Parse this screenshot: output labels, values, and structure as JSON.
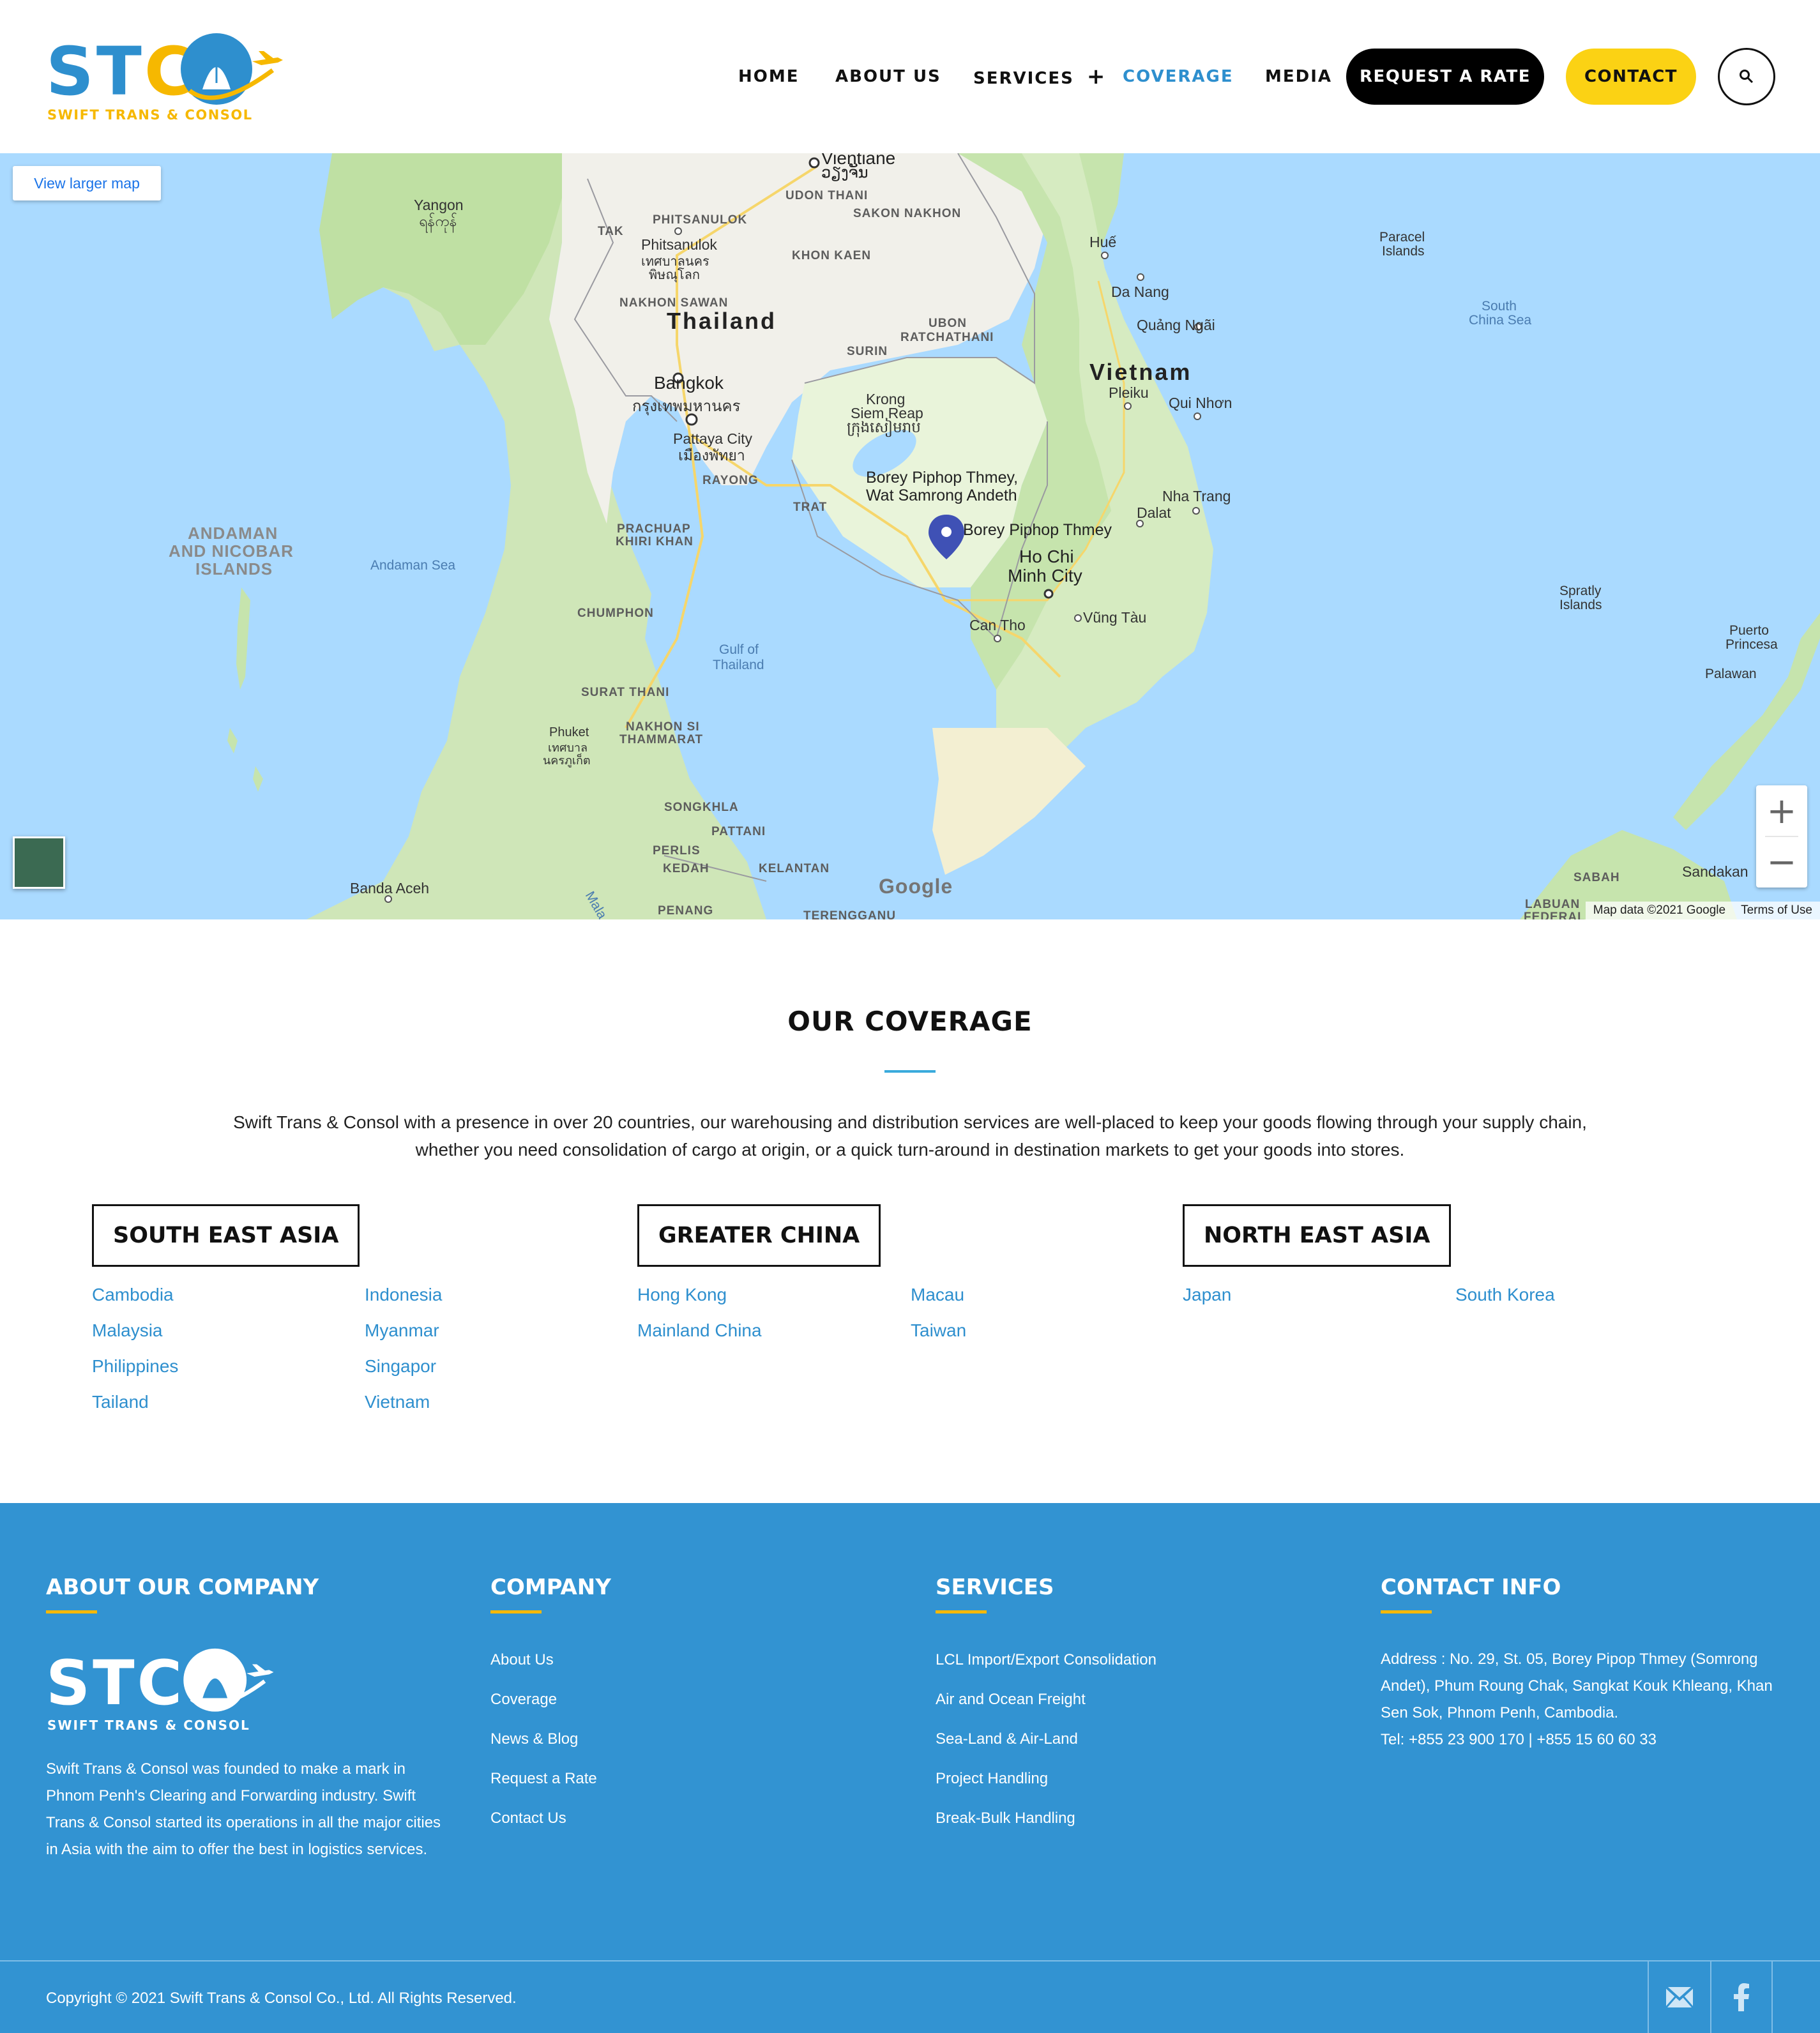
{
  "brand": {
    "letters": "STC",
    "tagline": "SWIFT TRANS & CONSOL",
    "colors": {
      "blue": "#2e8fce",
      "yellow": "#f6b800",
      "footer_bg": "#3293d2",
      "black": "#000000"
    }
  },
  "nav": {
    "items": [
      "HOME",
      "ABOUT US",
      "SERVICES",
      "COVERAGE",
      "MEDIA"
    ],
    "plus": "+",
    "active": "COVERAGE",
    "request_rate": "REQUEST A RATE",
    "contact": "CONTACT",
    "search_icon": "search-icon"
  },
  "map": {
    "view_larger": "View larger map",
    "zoom_in": "+",
    "zoom_out": "−",
    "google": "Google",
    "map_data": "Map data ©2021 Google",
    "terms": "Terms of Use",
    "labels": {
      "vientiane": "Vientiane",
      "vientiane_lao": "ວຽງຈັນ",
      "udon": "UDON THANI",
      "sakon": "SAKON NAKHON",
      "yangon": "Yangon",
      "yangon_my": "ရန်ကုန်",
      "phitsanulok_prov": "PHITSANULOK",
      "tak": "TAK",
      "phitsanulok": "Phitsanulok",
      "phitsanulok_th": "เทศบาลนคร",
      "phitsanulok_th2": "พิษณุโลก",
      "khon_kaen": "KHON KAEN",
      "hue": "Huế",
      "da_nang": "Da Nang",
      "quang_ngai": "Quảng Ngãi",
      "paracel": "Paracel",
      "paracel2": "Islands",
      "scs": "South",
      "scs2": "China Sea",
      "nakhon_sawan": "NAKHON SAWAN",
      "thailand": "Thailand",
      "ubon": "UBON",
      "ubon2": "RATCHATHANI",
      "surin": "SURIN",
      "vietnam": "Vietnam",
      "pleiku": "Pleiku",
      "qui_nhon": "Qui Nhơn",
      "bangkok": "Bangkok",
      "bangkok_th": "กรุงเทพมหานคร",
      "krong": "Krong",
      "siem_reap": "Siem Reap",
      "siem_reap_km": "ក្រុងសៀមរាប",
      "pattaya": "Pattaya City",
      "pattaya_th": "เมืองพัทยา",
      "rayong": "RAYONG",
      "borey_long": "Borey Piphop Thmey,",
      "borey_long2": "Wat Samrong Andeth",
      "nha_trang": "Nha Trang",
      "andaman1": "ANDAMAN",
      "andaman2": "AND NICOBAR",
      "andaman3": "ISLANDS",
      "andaman_sea": "Andaman Sea",
      "prachuap": "PRACHUAP",
      "prachuap2": "KHIRI KHAN",
      "trat": "TRAT",
      "dalat": "Dalat",
      "borey_pin": "Borey Piphop Thmey",
      "hcm": "Ho Chi",
      "hcm2": "Minh City",
      "chumphon": "CHUMPHON",
      "vung_tau": "Vũng Tàu",
      "spratly": "Spratly",
      "spratly2": "Islands",
      "can_tho": "Can Tho",
      "puerto": "Puerto",
      "puerto2": "Princesa",
      "gulf": "Gulf of",
      "gulf2": "Thailand",
      "palawan": "Palawan",
      "surat": "SURAT THANI",
      "nakhon_si": "NAKHON SI",
      "nakhon_si2": "THAMMARAT",
      "phuket": "Phuket",
      "phuket_th": "เทศบาล",
      "phuket_th2": "นครภูเก็ต",
      "songkhla": "SONGKHLA",
      "pattani": "PATTANI",
      "perlis": "PERLIS",
      "kedah": "KEDAH",
      "kelantan": "KELANTAN",
      "sabah": "SABAH",
      "sandakan": "Sandakan",
      "banda_aceh": "Banda Aceh",
      "penang": "PENANG",
      "terengganu": "TERENGGANU",
      "labuan": "LABUAN",
      "labuan2": "FEDERAL",
      "mala": "Mala"
    }
  },
  "coverage": {
    "title": "OUR COVERAGE",
    "description_line1": "Swift Trans & Consol with a presence in over 20 countries, our warehousing and distribution services are well-placed to keep your goods flowing through your supply chain,",
    "description_line2": "whether you need consolidation of cargo at origin, or a quick turn-around in destination markets to get your goods into stores.",
    "regions": [
      {
        "name": "SOUTH EAST ASIA",
        "col1": [
          "Cambodia",
          "Malaysia",
          "Philippines",
          "Tailand"
        ],
        "col2": [
          "Indonesia",
          "Myanmar",
          "Singapor",
          "Vietnam"
        ]
      },
      {
        "name": "GREATER CHINA",
        "col1": [
          "Hong Kong",
          "Mainland China"
        ],
        "col2": [
          "Macau",
          "Taiwan"
        ]
      },
      {
        "name": "NORTH EAST ASIA",
        "col1": [
          "Japan"
        ],
        "col2": [
          "South Korea"
        ]
      }
    ]
  },
  "footer": {
    "about_title": "ABOUT OUR COMPANY",
    "about_text": "Swift Trans & Consol was founded to make a mark in Phnom Penh's Clearing and Forwarding industry. Swift Trans & Consol started its operations in all the major cities in Asia with the aim to offer the best in logistics services.",
    "company_title": "COMPANY",
    "company_links": [
      "About Us",
      "Coverage",
      "News & Blog",
      "Request a Rate",
      "Contact Us"
    ],
    "services_title": "SERVICES",
    "services_links": [
      "LCL Import/Export Consolidation",
      "Air and Ocean Freight",
      "Sea-Land & Air-Land",
      "Project Handling",
      "Break-Bulk Handling"
    ],
    "contact_title": "CONTACT INFO",
    "address": "Address : No. 29, St. 05, Borey Pipop Thmey (Somrong Andet), Phum Roung Chak, Sangkat Kouk Khleang, Khan Sen Sok, Phnom Penh, Cambodia.",
    "tel": "Tel: +855 23 900 170 | +855 15 60 60 33",
    "copyright": "Copyright © 2021 Swift Trans & Consol Co., Ltd. All Rights Reserved.",
    "social": [
      "email-icon",
      "facebook-icon"
    ]
  }
}
